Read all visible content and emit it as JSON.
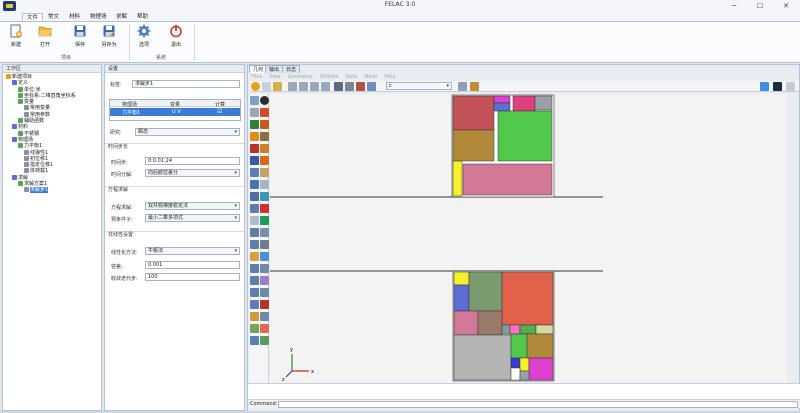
{
  "window": {
    "title": "FELAC 3.0",
    "minimize": "─",
    "maximize": "☐",
    "close": "✕"
  },
  "menu": [
    "文件",
    "常文",
    "材料",
    "物理场",
    "求解",
    "帮助"
  ],
  "ribbon": {
    "buttons": [
      {
        "label": "新建",
        "icon": "new-document-icon"
      },
      {
        "label": "打开",
        "icon": "folder-open-icon"
      },
      {
        "label": "保存",
        "icon": "save-icon"
      },
      {
        "label": "另存为",
        "icon": "save-as-icon"
      },
      {
        "label": "选项",
        "icon": "gear-icon"
      },
      {
        "label": "退出",
        "icon": "power-icon"
      }
    ],
    "groups": [
      "项目",
      "系统"
    ]
  },
  "left_panel": {
    "title": "工作区",
    "tree": [
      {
        "label": "新建项目",
        "depth": 0
      },
      {
        "label": "定义",
        "depth": 1
      },
      {
        "label": "单位:米",
        "depth": 2
      },
      {
        "label": "坐标系:二维直角坐标系",
        "depth": 2
      },
      {
        "label": "变量",
        "depth": 2
      },
      {
        "label": "常用变量",
        "depth": 3
      },
      {
        "label": "常用参数",
        "depth": 3
      },
      {
        "label": "辅助函数",
        "depth": 2
      },
      {
        "label": "材料",
        "depth": 1
      },
      {
        "label": "不锈钢",
        "depth": 2
      },
      {
        "label": "物理场",
        "depth": 1
      },
      {
        "label": "力平衡1",
        "depth": 2
      },
      {
        "label": "线弹性1",
        "depth": 3
      },
      {
        "label": "初位移1",
        "depth": 3
      },
      {
        "label": "指定位移1",
        "depth": 3
      },
      {
        "label": "体荷载1",
        "depth": 3
      },
      {
        "label": "求解",
        "depth": 1
      },
      {
        "label": "求解方案1",
        "depth": 2
      },
      {
        "label": "求解步1",
        "depth": 3
      }
    ]
  },
  "settings": {
    "title": "设置",
    "label_caption": "标签:",
    "label_value": "求解步1",
    "table": {
      "headers": [
        "物理场",
        "变量",
        "计算"
      ],
      "row": {
        "field": "力平衡1",
        "variable": "U V",
        "compute": "☑"
      }
    },
    "study_caption": "研究:",
    "study_value": "瞬态",
    "time_section": "时间步长",
    "time_step_caption": "时间步:",
    "time_step_value": "0:0.01:24",
    "time_disc_caption": "时间分解:",
    "time_disc_value": "向后欧拉差分",
    "eq_section": "方程求解",
    "eq_solve_caption": "方程求解:",
    "eq_solve_value": "双共轭梯度稳定法",
    "precond_caption": "预条件子:",
    "precond_value": "最小二乘多项式",
    "nonlin_section": "非线性设置",
    "nonlin_method_caption": "线性化方法:",
    "nonlin_method_value": "牛顿法",
    "tolerance_caption": "容差:",
    "tolerance_value": "0.001",
    "maxiter_caption": "收敛迭代步:",
    "maxiter_value": "100"
  },
  "right_panel": {
    "tabs": [
      "几何",
      "输出",
      "日志"
    ],
    "geometry_menu": [
      "Files",
      "View",
      "Geometry",
      "Utilities",
      "Data",
      "Mesh",
      "Help"
    ],
    "combo_value": "c",
    "command_label": "Command:"
  },
  "colors": {
    "accent": "#3a7bd5",
    "ribbon_bg": "#fbfcfd",
    "axis_x": "#d62020",
    "axis_y": "#1b8f1b",
    "axis_z": "#2040c8"
  }
}
